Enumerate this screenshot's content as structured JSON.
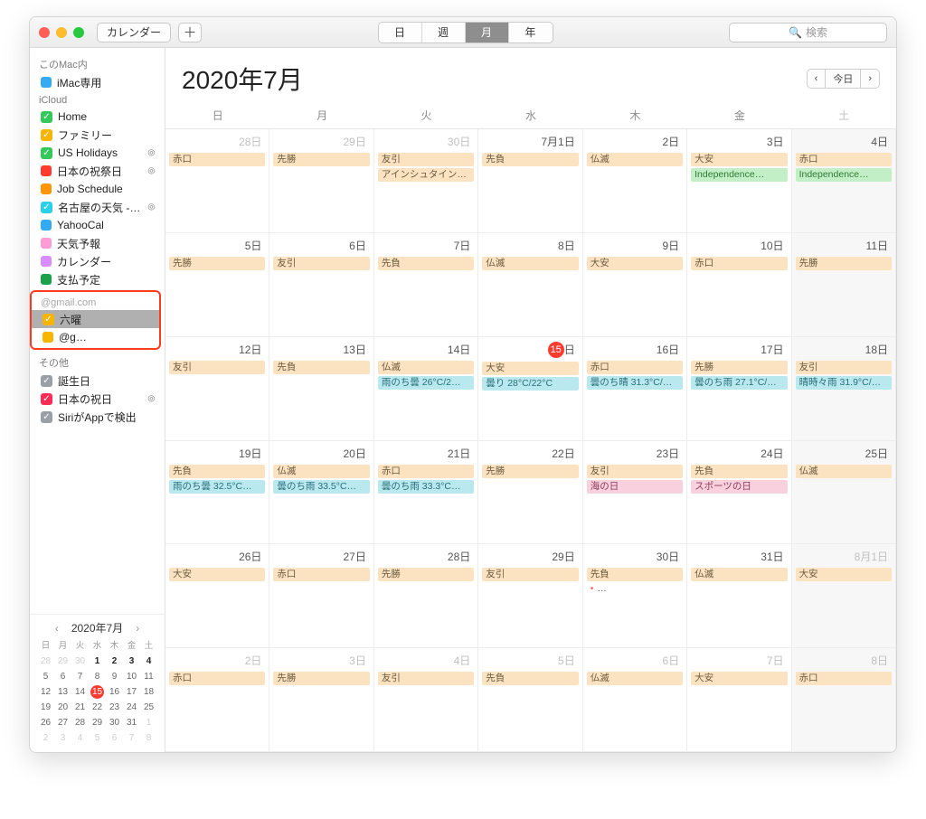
{
  "titlebar": {
    "app_button": "カレンダー",
    "segments": [
      "日",
      "週",
      "月",
      "年"
    ],
    "active_segment": 2,
    "search_placeholder": "検索"
  },
  "sidebar": {
    "sections": [
      {
        "label": "このMac内",
        "items": [
          {
            "color": "#34aaf2",
            "square": true,
            "label": "iMac専用"
          }
        ]
      },
      {
        "label": "iCloud",
        "items": [
          {
            "color": "#34c759",
            "checked": true,
            "label": "Home"
          },
          {
            "color": "#f7b500",
            "checked": true,
            "label": "ファミリー"
          },
          {
            "color": "#34c759",
            "checked": true,
            "label": "US Holidays",
            "rss": true
          },
          {
            "color": "#ff3b30",
            "square": true,
            "label": "日本の祝祭日",
            "rss": true
          },
          {
            "color": "#ff9500",
            "square": true,
            "label": "Job Schedule"
          },
          {
            "color": "#2ad0e6",
            "checked": true,
            "label": "名古屋の天気 -…",
            "rss": true
          },
          {
            "color": "#34aaf2",
            "square": true,
            "label": "YahooCal"
          },
          {
            "color": "#ff9cd5",
            "square": true,
            "label": "天気予報"
          },
          {
            "color": "#d98cff",
            "square": true,
            "label": "カレンダー"
          },
          {
            "color": "#1aa24a",
            "square": true,
            "label": "支払予定"
          }
        ]
      },
      {
        "label_account": "@gmail.com",
        "highlight": true,
        "items": [
          {
            "color": "#f7b500",
            "checked": true,
            "label": "六曜",
            "selected": true
          },
          {
            "color": "#f7b500",
            "square": true,
            "label": "@g…"
          }
        ]
      },
      {
        "label": "その他",
        "items": [
          {
            "color": "#9aa0a6",
            "checked": true,
            "label": "誕生日"
          },
          {
            "color": "#ff2d55",
            "checked": true,
            "label": "日本の祝日",
            "rss": true
          },
          {
            "color": "#9aa0a6",
            "checked": true,
            "label": "SiriがAppで検出"
          }
        ]
      }
    ]
  },
  "main": {
    "title": "2020年7月",
    "today_label": "今日",
    "weekdays": [
      "日",
      "月",
      "火",
      "水",
      "木",
      "金",
      "土"
    ]
  },
  "mini": {
    "title": "2020年7月",
    "weekdays": [
      "日",
      "月",
      "火",
      "水",
      "木",
      "金",
      "土"
    ],
    "rows": [
      [
        {
          "n": "28",
          "o": 1
        },
        {
          "n": "29",
          "o": 1
        },
        {
          "n": "30",
          "o": 1
        },
        {
          "n": "1",
          "b": 1
        },
        {
          "n": "2",
          "b": 1
        },
        {
          "n": "3",
          "b": 1
        },
        {
          "n": "4",
          "b": 1
        }
      ],
      [
        {
          "n": "5"
        },
        {
          "n": "6"
        },
        {
          "n": "7"
        },
        {
          "n": "8"
        },
        {
          "n": "9"
        },
        {
          "n": "10"
        },
        {
          "n": "11"
        }
      ],
      [
        {
          "n": "12"
        },
        {
          "n": "13"
        },
        {
          "n": "14"
        },
        {
          "n": "15",
          "t": 1
        },
        {
          "n": "16"
        },
        {
          "n": "17"
        },
        {
          "n": "18"
        }
      ],
      [
        {
          "n": "19"
        },
        {
          "n": "20"
        },
        {
          "n": "21"
        },
        {
          "n": "22"
        },
        {
          "n": "23"
        },
        {
          "n": "24"
        },
        {
          "n": "25"
        }
      ],
      [
        {
          "n": "26"
        },
        {
          "n": "27"
        },
        {
          "n": "28"
        },
        {
          "n": "29"
        },
        {
          "n": "30"
        },
        {
          "n": "31"
        },
        {
          "n": "1",
          "o": 1
        }
      ],
      [
        {
          "n": "2",
          "o": 1
        },
        {
          "n": "3",
          "o": 1
        },
        {
          "n": "4",
          "o": 1
        },
        {
          "n": "5",
          "o": 1
        },
        {
          "n": "6",
          "o": 1
        },
        {
          "n": "7",
          "o": 1
        },
        {
          "n": "8",
          "o": 1
        }
      ]
    ]
  },
  "grid": [
    [
      {
        "date": "28日",
        "prev": 1,
        "events": [
          {
            "t": "赤口",
            "c": "orange"
          }
        ]
      },
      {
        "date": "29日",
        "prev": 1,
        "events": [
          {
            "t": "先勝",
            "c": "orange"
          }
        ]
      },
      {
        "date": "30日",
        "prev": 1,
        "events": [
          {
            "t": "友引",
            "c": "orange"
          },
          {
            "t": "アインシュタイン…",
            "c": "orange"
          }
        ]
      },
      {
        "date": "7月1日",
        "events": [
          {
            "t": "先負",
            "c": "orange"
          }
        ]
      },
      {
        "date": "2日",
        "events": [
          {
            "t": "仏滅",
            "c": "orange"
          }
        ]
      },
      {
        "date": "3日",
        "events": [
          {
            "t": "大安",
            "c": "orange"
          },
          {
            "t": "Independence…",
            "c": "green"
          }
        ]
      },
      {
        "date": "4日",
        "sat": 1,
        "events": [
          {
            "t": "赤口",
            "c": "orange"
          },
          {
            "t": "Independence…",
            "c": "green"
          }
        ]
      }
    ],
    [
      {
        "date": "5日",
        "events": [
          {
            "t": "先勝",
            "c": "orange"
          }
        ]
      },
      {
        "date": "6日",
        "events": [
          {
            "t": "友引",
            "c": "orange"
          }
        ]
      },
      {
        "date": "7日",
        "events": [
          {
            "t": "先負",
            "c": "orange"
          }
        ]
      },
      {
        "date": "8日",
        "events": [
          {
            "t": "仏滅",
            "c": "orange"
          }
        ]
      },
      {
        "date": "9日",
        "events": [
          {
            "t": "大安",
            "c": "orange"
          }
        ]
      },
      {
        "date": "10日",
        "events": [
          {
            "t": "赤口",
            "c": "orange"
          }
        ]
      },
      {
        "date": "11日",
        "sat": 1,
        "events": [
          {
            "t": "先勝",
            "c": "orange"
          }
        ]
      }
    ],
    [
      {
        "date": "12日",
        "events": [
          {
            "t": "友引",
            "c": "orange"
          }
        ]
      },
      {
        "date": "13日",
        "events": [
          {
            "t": "先負",
            "c": "orange"
          }
        ]
      },
      {
        "date": "14日",
        "events": [
          {
            "t": "仏滅",
            "c": "orange"
          },
          {
            "t": "雨のち曇 26°C/2…",
            "c": "cyan"
          }
        ]
      },
      {
        "date": "日",
        "today": "15",
        "events": [
          {
            "t": "大安",
            "c": "orange"
          },
          {
            "t": "曇り 28°C/22°C",
            "c": "cyan"
          }
        ]
      },
      {
        "date": "16日",
        "events": [
          {
            "t": "赤口",
            "c": "orange"
          },
          {
            "t": "曇のち晴 31.3°C/…",
            "c": "cyan"
          }
        ]
      },
      {
        "date": "17日",
        "events": [
          {
            "t": "先勝",
            "c": "orange"
          },
          {
            "t": "曇のち雨 27.1°C/…",
            "c": "cyan"
          }
        ]
      },
      {
        "date": "18日",
        "sat": 1,
        "events": [
          {
            "t": "友引",
            "c": "orange"
          },
          {
            "t": "晴時々雨 31.9°C/…",
            "c": "cyan"
          }
        ]
      }
    ],
    [
      {
        "date": "19日",
        "events": [
          {
            "t": "先負",
            "c": "orange"
          },
          {
            "t": "雨のち曇 32.5°C…",
            "c": "cyan"
          }
        ]
      },
      {
        "date": "20日",
        "events": [
          {
            "t": "仏滅",
            "c": "orange"
          },
          {
            "t": "曇のち雨 33.5°C…",
            "c": "cyan"
          }
        ]
      },
      {
        "date": "21日",
        "events": [
          {
            "t": "赤口",
            "c": "orange"
          },
          {
            "t": "曇のち雨 33.3°C…",
            "c": "cyan"
          }
        ]
      },
      {
        "date": "22日",
        "events": [
          {
            "t": "先勝",
            "c": "orange"
          }
        ]
      },
      {
        "date": "23日",
        "events": [
          {
            "t": "友引",
            "c": "orange"
          },
          {
            "t": "海の日",
            "c": "pink"
          }
        ]
      },
      {
        "date": "24日",
        "events": [
          {
            "t": "先負",
            "c": "orange"
          },
          {
            "t": "スポーツの日",
            "c": "pink"
          }
        ]
      },
      {
        "date": "25日",
        "sat": 1,
        "events": [
          {
            "t": "仏滅",
            "c": "orange"
          }
        ]
      }
    ],
    [
      {
        "date": "26日",
        "events": [
          {
            "t": "大安",
            "c": "orange"
          }
        ]
      },
      {
        "date": "27日",
        "events": [
          {
            "t": "赤口",
            "c": "orange"
          }
        ]
      },
      {
        "date": "28日",
        "events": [
          {
            "t": "先勝",
            "c": "orange"
          }
        ]
      },
      {
        "date": "29日",
        "events": [
          {
            "t": "友引",
            "c": "orange"
          }
        ]
      },
      {
        "date": "30日",
        "events": [
          {
            "t": "先負",
            "c": "orange"
          },
          {
            "t": "…",
            "c": "dot"
          }
        ]
      },
      {
        "date": "31日",
        "events": [
          {
            "t": "仏滅",
            "c": "orange"
          }
        ]
      },
      {
        "date": "8月1日",
        "sat": 1,
        "next": 1,
        "events": [
          {
            "t": "大安",
            "c": "orange"
          }
        ]
      }
    ],
    [
      {
        "date": "2日",
        "next": 1,
        "events": [
          {
            "t": "赤口",
            "c": "orange"
          }
        ]
      },
      {
        "date": "3日",
        "next": 1,
        "events": [
          {
            "t": "先勝",
            "c": "orange"
          }
        ]
      },
      {
        "date": "4日",
        "next": 1,
        "events": [
          {
            "t": "友引",
            "c": "orange"
          }
        ]
      },
      {
        "date": "5日",
        "next": 1,
        "events": [
          {
            "t": "先負",
            "c": "orange"
          }
        ]
      },
      {
        "date": "6日",
        "next": 1,
        "events": [
          {
            "t": "仏滅",
            "c": "orange"
          }
        ]
      },
      {
        "date": "7日",
        "next": 1,
        "events": [
          {
            "t": "大安",
            "c": "orange"
          }
        ]
      },
      {
        "date": "8日",
        "sat": 1,
        "next": 1,
        "events": [
          {
            "t": "赤口",
            "c": "orange"
          }
        ]
      }
    ]
  ]
}
